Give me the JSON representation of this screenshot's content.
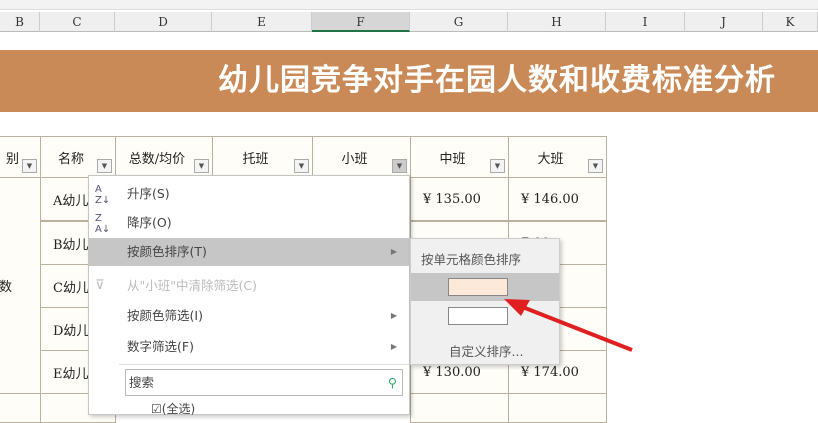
{
  "columns": [
    "B",
    "C",
    "D",
    "E",
    "F",
    "G",
    "H",
    "I",
    "J",
    "K"
  ],
  "title": "幼儿园竞争对手在园人数和收费标准分析",
  "headers": [
    "别",
    "名称",
    "总数/均价",
    "托班",
    "小班",
    "中班",
    "大班"
  ],
  "row_label": "数",
  "names": [
    "A幼儿",
    "B幼儿",
    "C幼儿",
    "D幼儿",
    "E幼儿"
  ],
  "mid": [
    "¥ 135.00",
    "",
    "",
    "",
    "¥ 130.00"
  ],
  "big": [
    "¥ 146.00",
    "7.00",
    "7.00",
    "6.00",
    "¥ 174.00"
  ],
  "menu": {
    "asc": "升序(S)",
    "desc": "降序(O)",
    "sort_color": "按颜色排序(T)",
    "clear": "从\"小班\"中清除筛选(C)",
    "filter_color": "按颜色筛选(I)",
    "num_filter": "数字筛选(F)",
    "search_placeholder": "搜索",
    "select_all": "(全选)",
    "asc_icon": "A\nZ↓",
    "desc_icon": "Z\nA↓"
  },
  "submenu": {
    "title": "按单元格颜色排序",
    "custom": "自定义排序...",
    "swatch1": "#fde9d9",
    "swatch2": "#ffffff"
  }
}
